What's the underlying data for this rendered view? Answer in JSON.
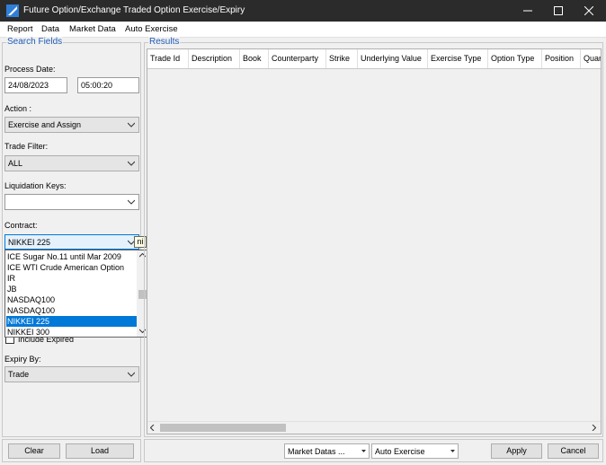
{
  "window": {
    "title": "Future Option/Exchange Traded Option Exercise/Expiry"
  },
  "menu": [
    "Report",
    "Data",
    "Market Data",
    "Auto Exercise"
  ],
  "search": {
    "title": "Search Fields",
    "process_date_label": "Process Date:",
    "date": "24/08/2023",
    "time": "05:00:20",
    "action_label": "Action :",
    "action_value": "Exercise and Assign",
    "trade_filter_label": "Trade Filter:",
    "trade_filter_value": "ALL",
    "liquidation_label": "Liquidation Keys:",
    "liquidation_value": "",
    "contract_label": "Contract:",
    "contract_value": "NIKKEI 225",
    "tooltip": "ni",
    "include_expired_label": "Include Expired",
    "expiry_by_label": "Expiry By:",
    "expiry_by_value": "Trade"
  },
  "contract_options": [
    "ICE Sugar No.11 until Mar 2009",
    "ICE WTI Crude American Option",
    "IR",
    "JB",
    "NASDAQ100",
    "NASDAQ100",
    "NIKKEI 225",
    "NIKKEI 300"
  ],
  "results": {
    "title": "Results",
    "columns": [
      "Trade Id",
      "Description",
      "Book",
      "Counterparty",
      "Strike",
      "Underlying Value",
      "Exercise Type",
      "Option Type",
      "Position",
      "Quan"
    ]
  },
  "footer": {
    "clear": "Clear",
    "load": "Load",
    "market_datas": "Market Datas ...",
    "auto_exercise": "Auto Exercise",
    "apply": "Apply",
    "cancel": "Cancel"
  }
}
